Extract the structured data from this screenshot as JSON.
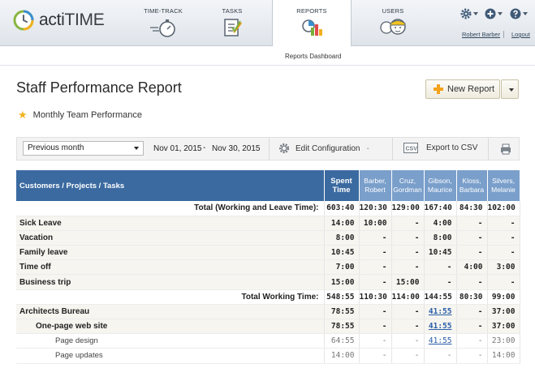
{
  "app": {
    "name_a": "acti",
    "name_b": "TIME"
  },
  "nav": {
    "time_track": "TIME-TRACK",
    "tasks": "TASKS",
    "reports": "REPORTS",
    "users": "USERS"
  },
  "user": {
    "name": "Robert Barber",
    "logout": "Logout"
  },
  "subnav": {
    "reports_dashboard": "Reports Dashboard"
  },
  "page": {
    "title": "Staff Performance Report",
    "new_report": "New Report",
    "report_name": "Monthly Team Performance"
  },
  "filters": {
    "period": "Previous month",
    "date_from": "Nov 01, 2015",
    "date_sep": "-",
    "date_to": "Nov 30, 2015",
    "edit_config": "Edit Configuration",
    "edit_config_dash": "-",
    "export_csv": "Export to CSV"
  },
  "table": {
    "head_first": "Customers / Projects / Tasks",
    "head_spent_1": "Spent",
    "head_spent_2": "Time",
    "users": [
      {
        "l1": "Barber,",
        "l2": "Robert"
      },
      {
        "l1": "Cruz,",
        "l2": "Gordman"
      },
      {
        "l1": "Gibson,",
        "l2": "Maurice"
      },
      {
        "l1": "Kloss,",
        "l2": "Barbara"
      },
      {
        "l1": "Silvers,",
        "l2": "Melanie"
      }
    ],
    "rows": [
      {
        "label": "Total (Working and Leave Time):",
        "cells": [
          "603:40",
          "120:30",
          "129:00",
          "167:40",
          "84:30",
          "102:00"
        ]
      },
      {
        "label": "Sick Leave",
        "cells": [
          "14:00",
          "10:00",
          "-",
          "4:00",
          "-",
          "-"
        ]
      },
      {
        "label": "Vacation",
        "cells": [
          "8:00",
          "-",
          "-",
          "8:00",
          "-",
          "-"
        ]
      },
      {
        "label": "Family leave",
        "cells": [
          "10:45",
          "-",
          "-",
          "10:45",
          "-",
          "-"
        ]
      },
      {
        "label": "Time off",
        "cells": [
          "7:00",
          "-",
          "-",
          "-",
          "4:00",
          "3:00"
        ]
      },
      {
        "label": "Business trip",
        "cells": [
          "15:00",
          "-",
          "15:00",
          "-",
          "-",
          "-"
        ]
      },
      {
        "label": "Total Working Time:",
        "cells": [
          "548:55",
          "110:30",
          "114:00",
          "144:55",
          "80:30",
          "99:00"
        ]
      },
      {
        "label": "Architects Bureau",
        "cells": [
          "78:55",
          "-",
          "-",
          "41:55",
          "-",
          "37:00"
        ]
      },
      {
        "label": "One-page web site",
        "cells": [
          "78:55",
          "-",
          "-",
          "41:55",
          "-",
          "37:00"
        ]
      },
      {
        "label": "Page design",
        "cells": [
          "64:55",
          "-",
          "-",
          "41:55",
          "-",
          "23:00"
        ]
      },
      {
        "label": "Page updates",
        "cells": [
          "14:00",
          "-",
          "-",
          "-",
          "-",
          "14:00"
        ]
      }
    ]
  },
  "colors": {
    "header_dark": "#3b6aa0",
    "header_light": "#7a9fcb",
    "accent": "#f4a21b"
  }
}
